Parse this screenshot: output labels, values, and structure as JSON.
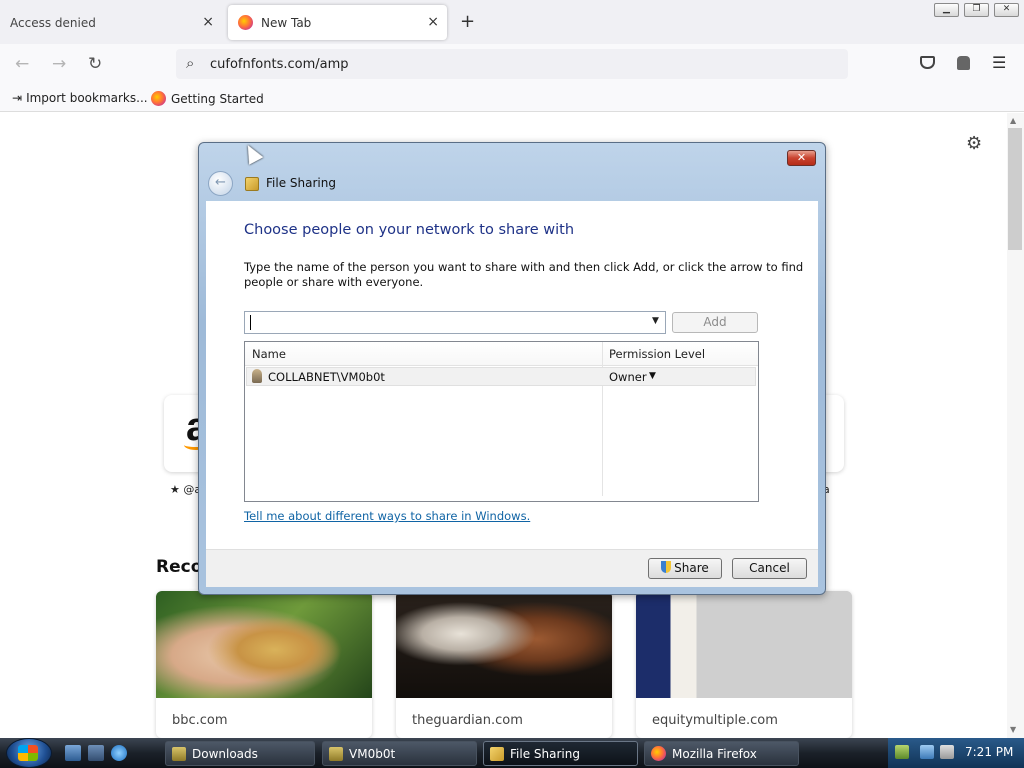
{
  "browser": {
    "tabs": [
      {
        "title": "Access denied",
        "close": "×"
      },
      {
        "title": "New Tab",
        "close": "×"
      }
    ],
    "new_tab": "+",
    "window_controls": {
      "minimize": "▁",
      "restore": "❐",
      "close": "✕"
    },
    "nav": {
      "back": "←",
      "forward": "→",
      "reload": "↻"
    },
    "url": "cufofnfonts.com/amp",
    "bookmarks": [
      {
        "icon": "import-icon",
        "label": "Import bookmarks..."
      },
      {
        "icon": "firefox-icon",
        "label": "Getting Started"
      }
    ]
  },
  "newtab": {
    "settings_icon": "⚙",
    "shortcut": {
      "letter": "a",
      "pin_label": "★ @a",
      "pin_right": "a"
    },
    "recommended_title": "Recon",
    "cards": [
      {
        "source": "bbc.com"
      },
      {
        "source": "theguardian.com"
      },
      {
        "source": "equitymultiple.com"
      }
    ]
  },
  "dialog": {
    "title": "File Sharing",
    "close": "✕",
    "back": "←",
    "heading": "Choose people on your network to share with",
    "instructions": "Type the name of the person you want to share with and then click Add, or click the arrow to find people or share with everyone.",
    "combo_value": "",
    "combo_arrow": "▼",
    "add_label": "Add",
    "columns": {
      "name": "Name",
      "permission": "Permission Level"
    },
    "rows": [
      {
        "name": "COLLABNET\\VM0b0t",
        "permission": "Owner",
        "arrow": "▼"
      }
    ],
    "help_link": "Tell me about different ways to share in Windows.",
    "share_label": "Share",
    "cancel_label": "Cancel"
  },
  "taskbar": {
    "items": [
      {
        "label": "Downloads",
        "active": false
      },
      {
        "label": "VM0b0t",
        "active": false
      },
      {
        "label": "File Sharing",
        "active": true
      },
      {
        "label": "Mozilla Firefox",
        "active": false
      }
    ],
    "clock": "7:21 PM"
  },
  "colors": {
    "accent": "#1e3287",
    "link": "#1064a5",
    "dialog_frame": "#a9c3df"
  }
}
